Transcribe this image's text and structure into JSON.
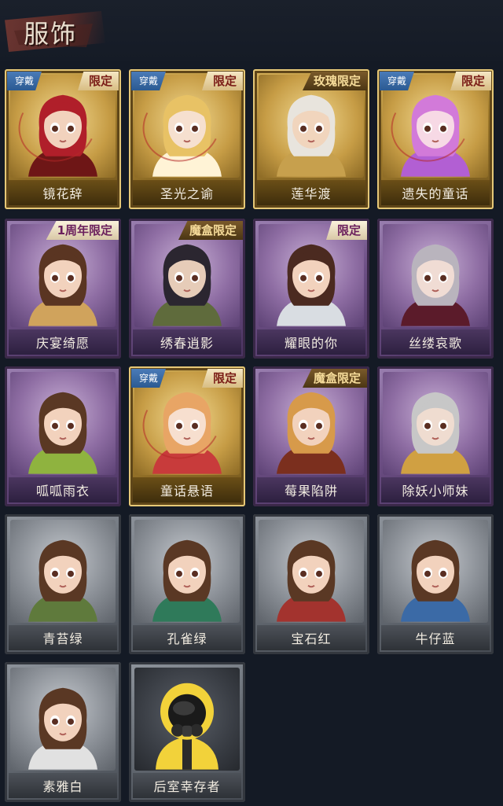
{
  "header": {
    "title": "服饰"
  },
  "badges": {
    "equipped": "穿戴",
    "limited": "限定",
    "glory_limited": "玫瑰限定",
    "anniversary_limited": "1周年限定",
    "magic_box_limited": "魔盒限定"
  },
  "costumes": [
    {
      "name": "镜花辞",
      "frame": "gold",
      "equipped": true,
      "tag": "限定",
      "hair": "#b01f2a",
      "skin": "#f2d2bd",
      "accent": "#6e1616"
    },
    {
      "name": "圣光之谕",
      "frame": "gold",
      "equipped": true,
      "tag": "限定",
      "hair": "#e8c265",
      "skin": "#f6e0cf",
      "accent": "#fff3d6"
    },
    {
      "name": "莲华渡",
      "frame": "gold",
      "equipped": false,
      "tag": "玫瑰限定",
      "hair": "#e8e4dd",
      "skin": "#f1d5bd",
      "accent": "#c7a04d"
    },
    {
      "name": "遗失的童话",
      "frame": "gold",
      "equipped": true,
      "tag": "限定",
      "hair": "#d27ad9",
      "skin": "#f7d9e5",
      "accent": "#b25fd3"
    },
    {
      "name": "庆宴绮愿",
      "frame": "purple",
      "equipped": false,
      "tag": "1周年限定",
      "hair": "#5a3522",
      "skin": "#f2d2bd",
      "accent": "#d0a35c"
    },
    {
      "name": "绣春逍影",
      "frame": "purple",
      "equipped": false,
      "tag": "魔盒限定",
      "hair": "#2b2630",
      "skin": "#e6ccb8",
      "accent": "#5f6b3c"
    },
    {
      "name": "耀眼的你",
      "frame": "purple",
      "equipped": false,
      "tag": "限定",
      "hair": "#4b2a20",
      "skin": "#f2d2bd",
      "accent": "#d9dde2"
    },
    {
      "name": "丝缕哀歌",
      "frame": "purple",
      "equipped": false,
      "tag": "",
      "hair": "#b9b4bd",
      "skin": "#f0dcd4",
      "accent": "#5b1b2a"
    },
    {
      "name": "呱呱雨衣",
      "frame": "purple",
      "equipped": false,
      "tag": "",
      "hair": "#5a3824",
      "skin": "#f2d2bd",
      "accent": "#8fb33f"
    },
    {
      "name": "童话悬语",
      "frame": "gold",
      "equipped": true,
      "tag": "限定",
      "hair": "#e8a565",
      "skin": "#f7dfcf",
      "accent": "#c83b3b"
    },
    {
      "name": "莓果陷阱",
      "frame": "purple",
      "equipped": false,
      "tag": "魔盒限定",
      "hair": "#d79a4a",
      "skin": "#f2d2bd",
      "accent": "#7b2f1e"
    },
    {
      "name": "除妖小师妹",
      "frame": "purple",
      "equipped": false,
      "tag": "",
      "hair": "#c7c7c7",
      "skin": "#efdcd0",
      "accent": "#d0a042"
    },
    {
      "name": "青苔绿",
      "frame": "gray",
      "equipped": false,
      "tag": "",
      "hair": "#5a3824",
      "skin": "#f2d2bd",
      "accent": "#5f7a3c"
    },
    {
      "name": "孔雀绿",
      "frame": "gray",
      "equipped": false,
      "tag": "",
      "hair": "#5a3824",
      "skin": "#f2d2bd",
      "accent": "#2f7a5a"
    },
    {
      "name": "宝石红",
      "frame": "gray",
      "equipped": false,
      "tag": "",
      "hair": "#5a3824",
      "skin": "#f2d2bd",
      "accent": "#a3332e"
    },
    {
      "name": "牛仔蓝",
      "frame": "gray",
      "equipped": false,
      "tag": "",
      "hair": "#5a3824",
      "skin": "#f2d2bd",
      "accent": "#3b6aa6"
    },
    {
      "name": "素雅白",
      "frame": "gray",
      "equipped": false,
      "tag": "",
      "hair": "#5a3824",
      "skin": "#f2d2bd",
      "accent": "#e1e1e1"
    },
    {
      "name": "后室幸存者",
      "frame": "gray",
      "equipped": false,
      "tag": "",
      "hair": "#1b1b1b",
      "skin": "#222222",
      "accent": "#f2d23a",
      "dark": true
    }
  ]
}
